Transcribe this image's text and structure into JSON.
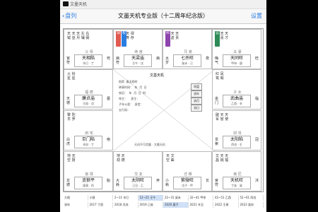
{
  "window": {
    "title": "文墨天机"
  },
  "toolbar": {
    "back_label": "盘列",
    "title": "文墨天机专业版（十二周年纪念版）",
    "settings_label": "设置"
  },
  "palaces": [
    {
      "stars": "天 天 天 左 右\n钺 巫 月 辅 弼",
      "name": "父 母",
      "main": "天相陷",
      "sub": "辛巳 · 丁",
      "left": "官\n符",
      "right": "死",
      "hua": []
    },
    {
      "stars": "天 天 天 禄\n魁 哭 寿 存",
      "name": "命 宫",
      "main": "天梁庙",
      "sub": "壬午 · 戊",
      "left": "病\n符",
      "right": "病",
      "hua": [
        {
          "color": "#e05a4f",
          "text": "禄"
        },
        {
          "color": "#2b7de1",
          "text": "权"
        }
      ]
    },
    {
      "stars": "天 天 天\n刑 虚 贵",
      "name": "兄 弟",
      "main": "七杀旺",
      "sub": "癸未 · 己",
      "left": "太\n岁",
      "right": "衰",
      "hua": [
        {
          "color": "#8e44ad",
          "text": "科"
        }
      ]
    },
    {
      "stars": "天 天 天\n哭 喜 才",
      "name": "夫 妻",
      "main": "天同旺",
      "sub": "甲申 · 庚",
      "left": "晦\n气",
      "right": "旺",
      "hua": [
        {
          "color": "#2e8b57",
          "text": "忌"
        }
      ]
    },
    {
      "stars": "红 凤\n鸾 阁",
      "name": "子 女",
      "main": "武曲庙",
      "sub": "乙酉 · 辛",
      "left": "丧\n门",
      "right": "临",
      "hua": []
    },
    {
      "stars": "破 天 天\n军 官 使",
      "name": "财 帛",
      "main": "太阳陷",
      "sub": "丙戌 · 壬",
      "left": "贯\n索",
      "right": "冠",
      "hua": []
    },
    {
      "stars": "文 天 天\n昌 姚 福",
      "name": "疾 厄",
      "main": "天机旺",
      "sub": "丁亥 · 癸",
      "left": "官\n符",
      "right": "沐",
      "hua": []
    },
    {
      "stars": "天 文\n空 曲",
      "name": "迁 移",
      "main": "紫微旺",
      "sub": "戊子 · 甲",
      "left": "小\n耗",
      "right": "长",
      "hua": []
    },
    {
      "stars": "地 天\n劫 德",
      "name": "交 友",
      "main": "太阴旺",
      "sub": "己丑 · 乙",
      "left": "大\n耗",
      "right": "养",
      "hua": []
    },
    {
      "stars": "地 天\n空 厨",
      "name": "官 禄",
      "main": "贪狼平",
      "sub": "庚寅 · 丙",
      "left": "龙\n德",
      "right": "胎",
      "hua": []
    },
    {
      "stars": "擎 陀\n羊 罗",
      "name": "田 宅",
      "main": "巨门陷",
      "sub": "辛卯 · 丁",
      "left": "白\n虎",
      "right": "绝",
      "hua": []
    },
    {
      "stars": "火 铃\n星 星",
      "name": "福 德",
      "main": "廉贞庙",
      "sub": "壬辰 · 戊",
      "left": "天\n德",
      "right": "墓",
      "hua": []
    }
  ],
  "center": {
    "name": "文墨天机",
    "info": "阳男  真太阳时\n钟表时间：  年  月  日\n农历：  年  月  日  时\n命主：    身主：\n子年斗君：  身宫：\n五行局：",
    "buttons": [
      "命盘",
      "流年",
      "流月",
      "流日"
    ],
    "foot": "天机不可泄露 · 文墨天机"
  },
  "bottom_rows": [
    [
      "大限",
      "小限",
      "2~11 辛巳",
      "12~21 壬午",
      "22~31 癸未",
      "32~41 甲申",
      "42~51 乙酉",
      "52~61 丙戌"
    ],
    [
      "流年",
      "2017 丁酉",
      "2018 戊戌",
      "2019 己亥",
      "2020 庚子",
      "2021 辛丑",
      "2022 壬寅",
      "2023 癸卯"
    ]
  ]
}
